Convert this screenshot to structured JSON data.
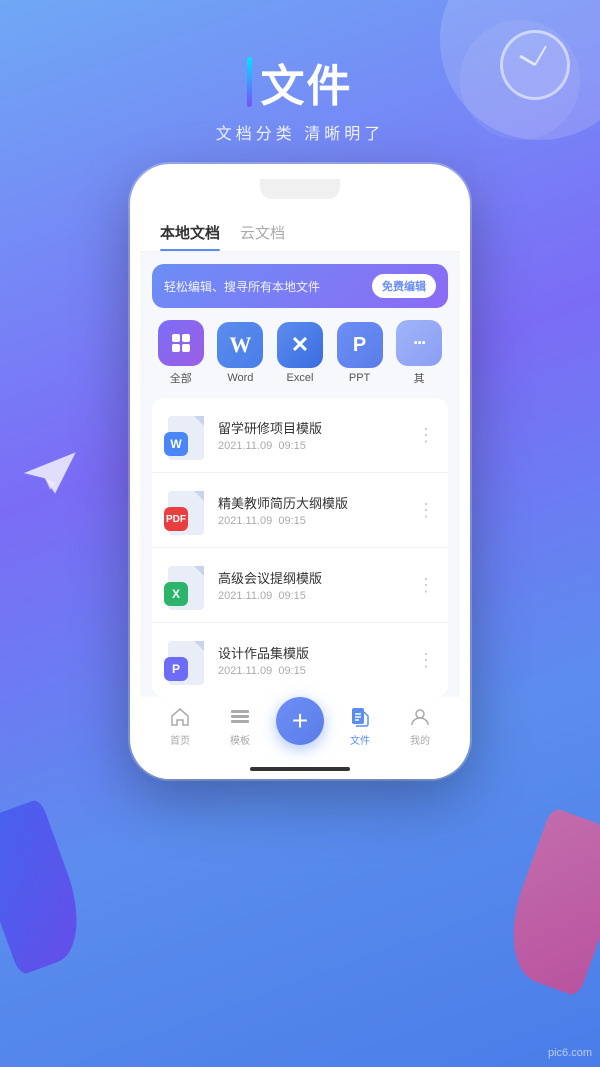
{
  "header": {
    "title": "文件",
    "subtitle": "文档分类  清晰明了",
    "bar_label": "vertical-bar"
  },
  "tabs": [
    {
      "label": "本地文档",
      "active": true
    },
    {
      "label": "云文档",
      "active": false
    }
  ],
  "search_banner": {
    "text": "轻松编辑、搜寻所有本地文件",
    "button": "免费编辑"
  },
  "file_types": [
    {
      "label": "全部",
      "type": "all"
    },
    {
      "label": "Word",
      "type": "word"
    },
    {
      "label": "Excel",
      "type": "excel"
    },
    {
      "label": "PPT",
      "type": "ppt"
    },
    {
      "label": "其",
      "type": "more"
    }
  ],
  "files": [
    {
      "name": "留学研修项目模版",
      "date": "2021.11.09",
      "time": "09:15",
      "type": "word"
    },
    {
      "name": "精美教师简历大纲模版",
      "date": "2021.11.09",
      "time": "09:15",
      "type": "pdf"
    },
    {
      "name": "高级会议提纲模版",
      "date": "2021.11.09",
      "time": "09:15",
      "type": "excel"
    },
    {
      "name": "设计作品集模版",
      "date": "2021.11.09",
      "time": "09:15",
      "type": "ppt"
    }
  ],
  "nav": {
    "items": [
      {
        "label": "首页",
        "active": false
      },
      {
        "label": "模板",
        "active": false
      },
      {
        "label": "",
        "active": false,
        "fab": true
      },
      {
        "label": "文件",
        "active": true
      },
      {
        "label": "我的",
        "active": false
      }
    ]
  },
  "watermark": "pic6.com"
}
